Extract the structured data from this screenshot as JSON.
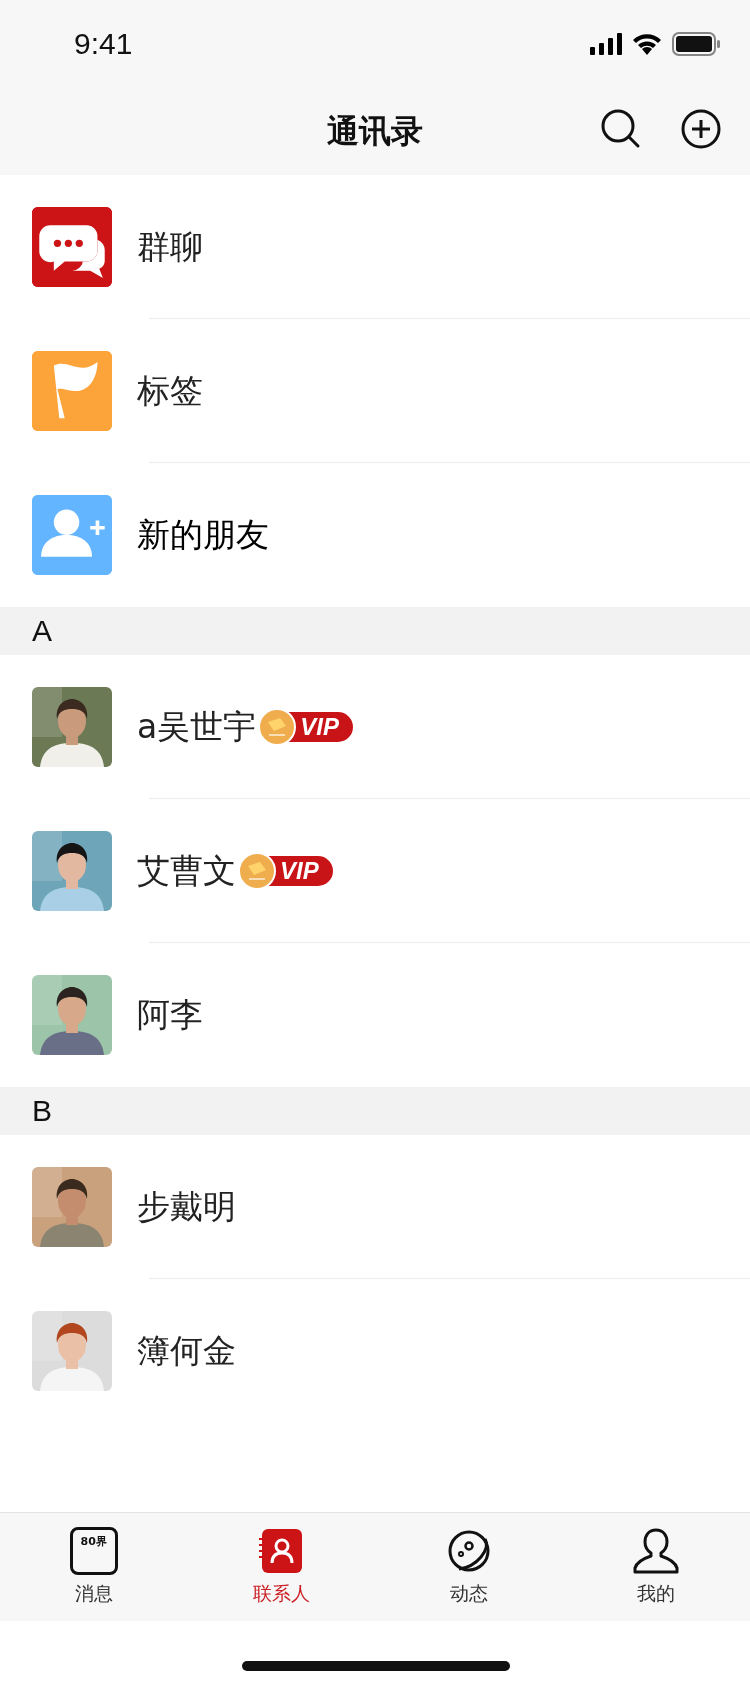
{
  "status_bar": {
    "time": "9:41"
  },
  "nav": {
    "title": "通讯录"
  },
  "functions": [
    {
      "kind": "group",
      "label": "群聊",
      "color": "#cc1417"
    },
    {
      "kind": "tag",
      "label": "标签",
      "color": "#fca33a"
    },
    {
      "kind": "new-friend",
      "label": "新的朋友",
      "color": "#63b5ff"
    }
  ],
  "sections": [
    {
      "letter": "A",
      "contacts": [
        {
          "name": "a吴世宇",
          "vip": true,
          "vip_label": "VIP"
        },
        {
          "name": "艾曹文",
          "vip": true,
          "vip_label": "VIP"
        },
        {
          "name": "阿李",
          "vip": false
        }
      ]
    },
    {
      "letter": "B",
      "contacts": [
        {
          "name": "步戴明",
          "vip": false
        },
        {
          "name": "簿何金",
          "vip": false
        }
      ]
    }
  ],
  "tabs": [
    {
      "kind": "messages",
      "label": "消息",
      "icon_text": "80界",
      "selected": false
    },
    {
      "kind": "contacts",
      "label": "联系人",
      "selected": true
    },
    {
      "kind": "moments",
      "label": "动态",
      "selected": false
    },
    {
      "kind": "me",
      "label": "我的",
      "selected": false
    }
  ]
}
